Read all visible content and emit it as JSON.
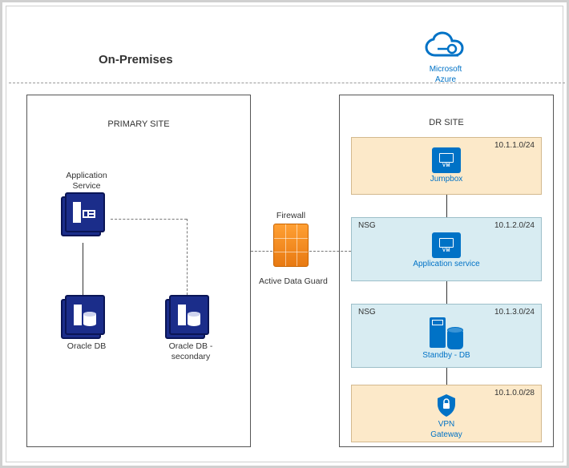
{
  "header": {
    "onprem_title": "On-Premises",
    "azure_label_line1": "Microsoft",
    "azure_label_line2": "Azure"
  },
  "primary": {
    "title": "PRIMARY SITE",
    "app_service_label": "Application Service",
    "oracle_db_label": "Oracle DB",
    "oracle_db_secondary_label": "Oracle DB - secondary"
  },
  "middle": {
    "firewall_label": "Firewall",
    "adg_label": "Active Data Guard"
  },
  "dr": {
    "title": "DR SITE",
    "subnets": {
      "jumpbox": {
        "cidr": "10.1.1.0/24",
        "label": "Jumpbox"
      },
      "appsvc": {
        "cidr": "10.1.2.0/24",
        "nsg": "NSG",
        "label": "Application service"
      },
      "standbydb": {
        "cidr": "10.1.3.0/24",
        "nsg": "NSG",
        "label": "Standby - DB"
      },
      "vpngw": {
        "cidr": "10.1.0.0/28",
        "label_line1": "VPN",
        "label_line2": "Gateway"
      }
    }
  }
}
